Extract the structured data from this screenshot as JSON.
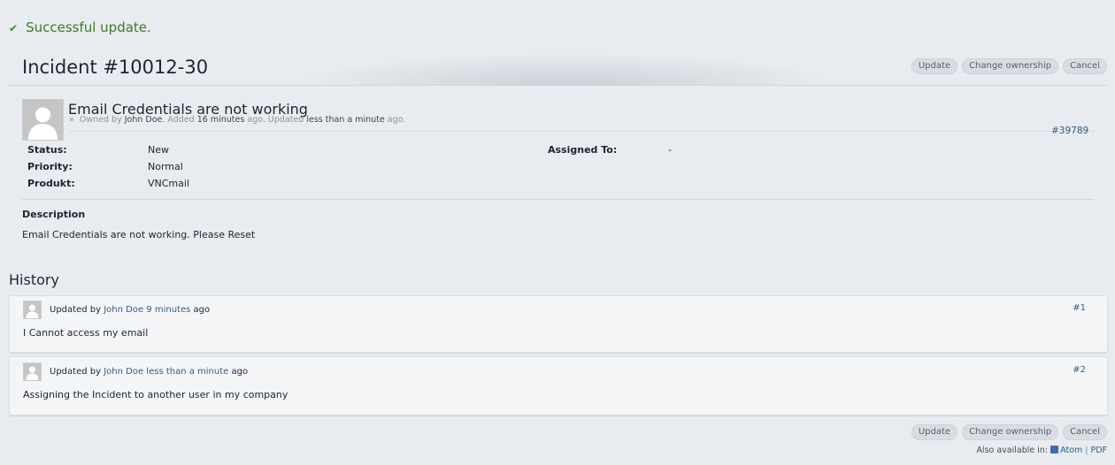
{
  "flash": {
    "message": "Successful update."
  },
  "page": {
    "title": "Incident #10012-30"
  },
  "actions": {
    "update": "Update",
    "change_ownership": "Change ownership",
    "cancel": "Cancel"
  },
  "issue": {
    "subject": "Email Credentials are not working",
    "meta": {
      "owned_by_prefix": "Owned by",
      "author": "John Doe",
      "added_prefix": ". Added",
      "added_ago": "16 minutes",
      "updated_prefix": "ago. Updated",
      "updated_ago": "less than a minute",
      "suffix": "ago."
    },
    "number": "#39789",
    "attributes_left": [
      {
        "label": "Status:",
        "value": "New"
      },
      {
        "label": "Priority:",
        "value": "Normal"
      },
      {
        "label": "Produkt:",
        "value": "VNCmail"
      }
    ],
    "attributes_right": [
      {
        "label": "Assigned To:",
        "value": "-"
      }
    ],
    "description_label": "Description",
    "description": "Email Credentials are not working. Please Reset"
  },
  "history": {
    "title": "History",
    "journals": [
      {
        "updated_by": "Updated by",
        "author": "John Doe",
        "ago": "9 minutes",
        "ago_suffix": "ago",
        "number": "#1",
        "note": "I Cannot access my email"
      },
      {
        "updated_by": "Updated by",
        "author": "John Doe",
        "ago": "less than a minute",
        "ago_suffix": "ago",
        "number": "#2",
        "note": "Assigning the Incident to another user in my company"
      }
    ]
  },
  "footer": {
    "also_available": "Also available in:",
    "atom": "Atom",
    "separator": "|",
    "pdf": "PDF"
  },
  "colors": {
    "background": "#e8ebef",
    "success": "#3d7a2b",
    "link": "#2f5f86",
    "button": "#d9dde3"
  }
}
